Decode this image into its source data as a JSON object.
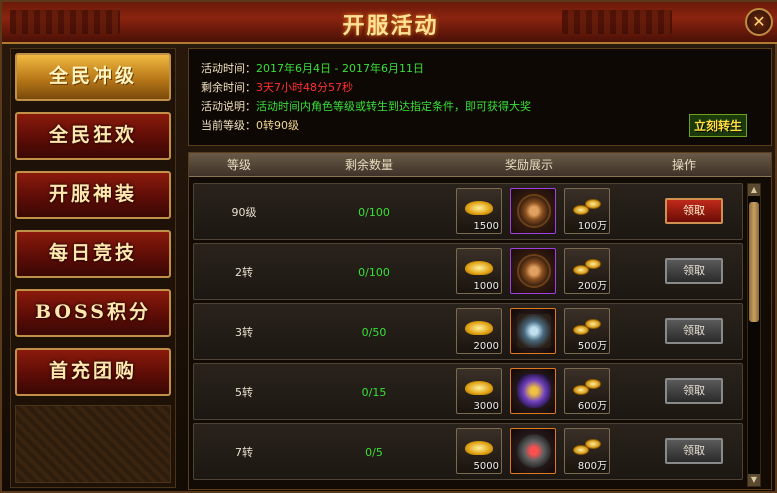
{
  "window": {
    "title": "开服活动",
    "close_label": "✕"
  },
  "sidebar": {
    "items": [
      {
        "label": "全民冲级",
        "active": true
      },
      {
        "label": "全民狂欢",
        "active": false
      },
      {
        "label": "开服神装",
        "active": false
      },
      {
        "label": "每日竞技",
        "active": false
      },
      {
        "label": "BOSS积分",
        "active": false
      },
      {
        "label": "首充团购",
        "active": false
      }
    ]
  },
  "info": {
    "time_label": "活动时间：",
    "time_value": "2017年6月4日 - 2017年6月11日",
    "remain_label": "剩余时间：",
    "remain_value": "3天7小时48分57秒",
    "desc_label": "活动说明：",
    "desc_value": "活动时间内角色等级或转生到达指定条件，即可获得大奖",
    "level_label": "当前等级：",
    "level_value": "0转90级",
    "transfer_button": "立刻转生"
  },
  "table": {
    "headers": [
      "等级",
      "剩余数量",
      "奖励展示",
      "操作"
    ],
    "rows": [
      {
        "level": "90级",
        "remaining": "0/100",
        "ingot": "1500",
        "item_icon": "bronze-medal-icon",
        "gold": "100万",
        "action": "领取",
        "action_active": true
      },
      {
        "level": "2转",
        "remaining": "0/100",
        "ingot": "1000",
        "item_icon": "bronze-medal-icon",
        "gold": "200万",
        "action": "领取",
        "action_active": false
      },
      {
        "level": "3转",
        "remaining": "0/50",
        "ingot": "2000",
        "item_icon": "crystal-armor-icon",
        "gold": "500万",
        "action": "领取",
        "action_active": false
      },
      {
        "level": "5转",
        "remaining": "0/15",
        "ingot": "3000",
        "item_icon": "winged-helm-icon",
        "gold": "600万",
        "action": "领取",
        "action_active": false
      },
      {
        "level": "7转",
        "remaining": "0/5",
        "ingot": "5000",
        "item_icon": "red-gem-ring-icon",
        "gold": "800万",
        "action": "领取",
        "action_active": false
      }
    ]
  },
  "colors": {
    "accent_green": "#38e038",
    "accent_red": "#ff3030",
    "gold": "#ffe29a"
  }
}
